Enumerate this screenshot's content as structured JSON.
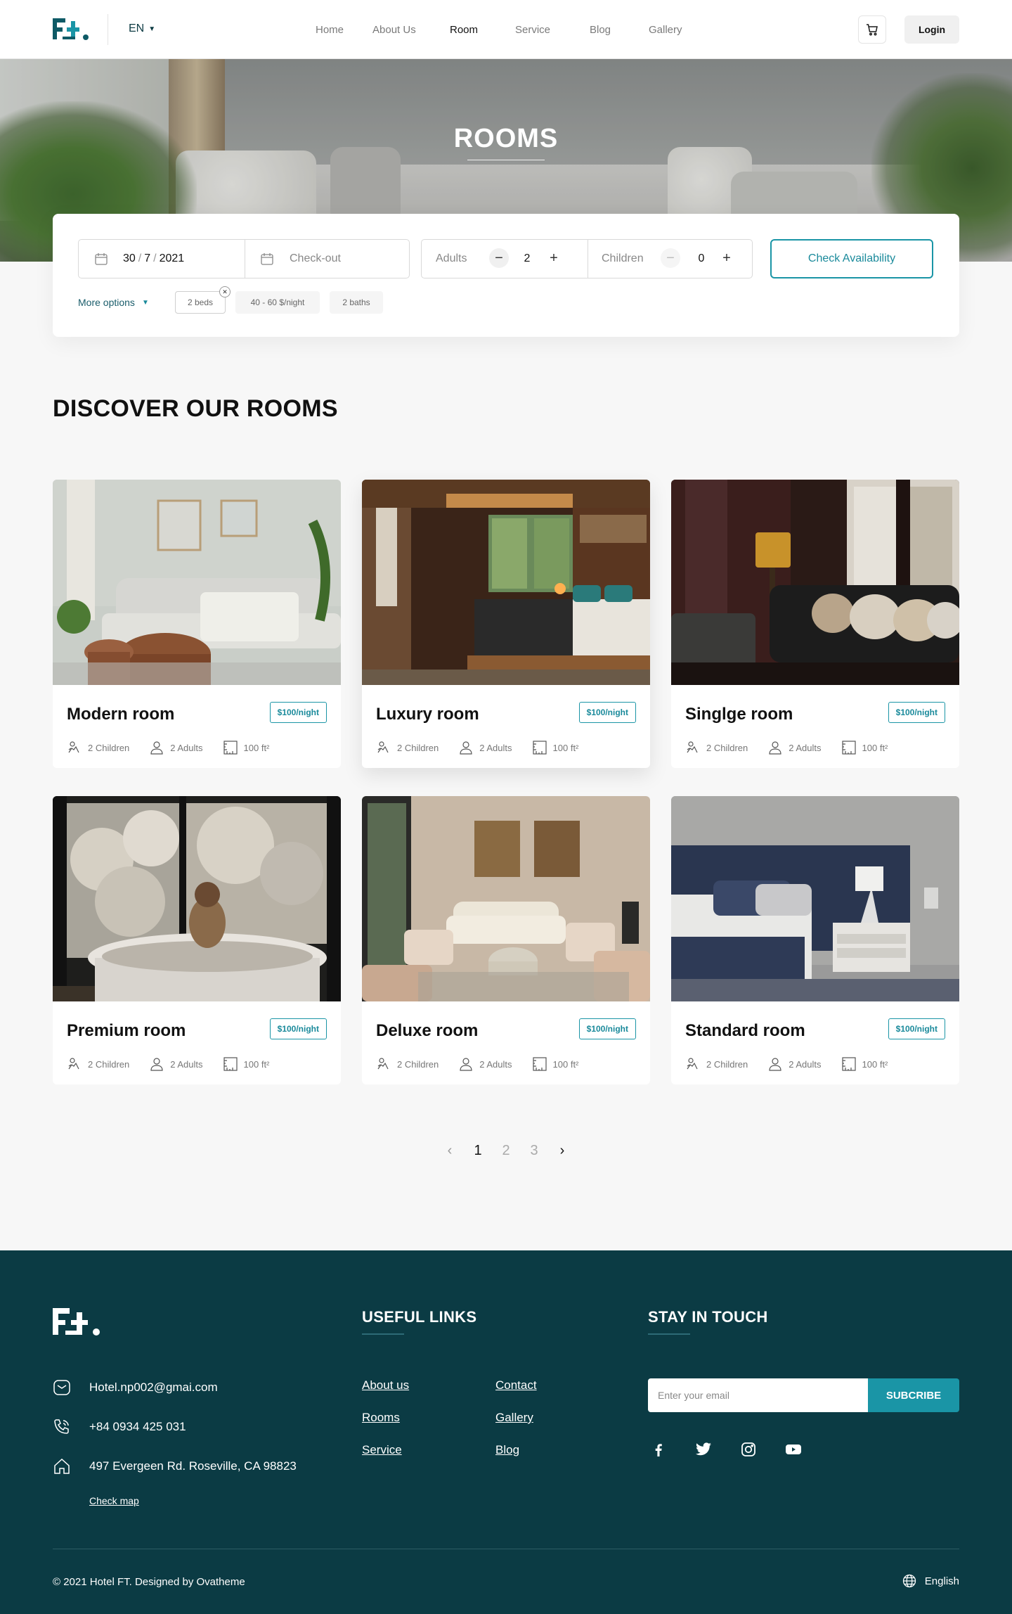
{
  "header": {
    "language": "EN",
    "nav": [
      {
        "label": "Home",
        "active": false
      },
      {
        "label": "About Us",
        "active": false
      },
      {
        "label": "Room",
        "active": true
      },
      {
        "label": "Service",
        "active": false
      },
      {
        "label": "Blog",
        "active": false
      },
      {
        "label": "Gallery",
        "active": false
      }
    ],
    "login_label": "Login"
  },
  "hero": {
    "title": "ROOMS"
  },
  "booking": {
    "checkin": {
      "day": "30",
      "month": "7",
      "year": "2021"
    },
    "checkout_placeholder": "Check-out",
    "adults_label": "Adults",
    "adults_value": "2",
    "children_label": "Children",
    "children_value": "0",
    "check_button": "Check Availability",
    "more_options": "More options",
    "chips": [
      "2 beds",
      "40 - 60 $/night",
      "2 baths"
    ]
  },
  "section_title": "DISCOVER OUR ROOMS",
  "rooms": [
    {
      "name": "Modern room",
      "price": "$100/night",
      "children": "2 Children",
      "adults": "2 Adults",
      "area": "100 ft²"
    },
    {
      "name": "Luxury room",
      "price": "$100/night",
      "children": "2 Children",
      "adults": "2 Adults",
      "area": "100 ft²"
    },
    {
      "name": "Singlge room",
      "price": "$100/night",
      "children": "2 Children",
      "adults": "2 Adults",
      "area": "100 ft²"
    },
    {
      "name": "Premium room",
      "price": "$100/night",
      "children": "2 Children",
      "adults": "2 Adults",
      "area": "100 ft²"
    },
    {
      "name": "Deluxe room",
      "price": "$100/night",
      "children": "2 Children",
      "adults": "2 Adults",
      "area": "100 ft²"
    },
    {
      "name": "Standard room",
      "price": "$100/night",
      "children": "2 Children",
      "adults": "2 Adults",
      "area": "100 ft²"
    }
  ],
  "pagination": {
    "pages": [
      "1",
      "2",
      "3"
    ],
    "current": "1",
    "prev": "‹",
    "next": "›"
  },
  "footer": {
    "email": "Hotel.np002@gmai.com",
    "phone": "+84 0934 425 031",
    "address": "497 Evergeen Rd. Roseville, CA 98823",
    "check_map": "Check map",
    "useful_links_title": "USEFUL LINKS",
    "links_col1": [
      "About us",
      "Rooms",
      "Service"
    ],
    "links_col2": [
      "Contact",
      "Gallery",
      "Blog"
    ],
    "stay_title": "STAY IN TOUCH",
    "email_placeholder": "Enter your email",
    "subscribe_label": "SUBCRIBE",
    "copyright": "© 2021 Hotel FT. Designed by Ovatheme",
    "language": "English"
  },
  "colors": {
    "brand_dark": "#0b3b44",
    "accent": "#1a95a6",
    "logo_teal": "#0e5a66"
  },
  "icons": [
    "logo",
    "cart-icon",
    "calendar-icon",
    "minus-icon",
    "plus-icon",
    "children-icon",
    "adult-icon",
    "area-icon",
    "mail-icon",
    "phone-icon",
    "home-icon",
    "facebook-icon",
    "twitter-icon",
    "instagram-icon",
    "youtube-icon",
    "globe-icon"
  ]
}
